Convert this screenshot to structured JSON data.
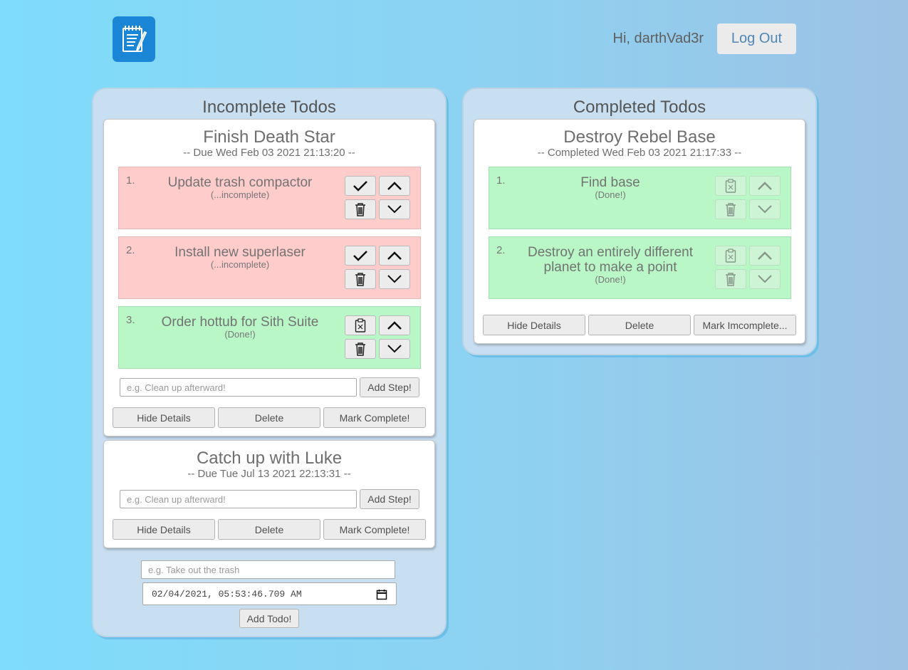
{
  "header": {
    "logo_icon": "notepad-pencil-icon",
    "greeting": "Hi, darthVad3r",
    "logout_label": "Log Out"
  },
  "incomplete": {
    "title": "Incomplete Todos",
    "todos": [
      {
        "title": "Finish Death Star",
        "subtitle": "-- Due Wed Feb 03 2021 21:13:20 --",
        "steps": [
          {
            "num": "1.",
            "title": "Update trash compactor",
            "status": "(...incomplete)",
            "state": "incomplete"
          },
          {
            "num": "2.",
            "title": "Install new superlaser",
            "status": "(...incomplete)",
            "state": "incomplete"
          },
          {
            "num": "3.",
            "title": "Order hottub for Sith Suite",
            "status": "(Done!)",
            "state": "done"
          }
        ],
        "step_placeholder": "e.g. Clean up afterward!",
        "add_step_label": "Add Step!",
        "hide_label": "Hide Details",
        "delete_label": "Delete",
        "mark_label": "Mark Complete!"
      },
      {
        "title": "Catch up with Luke",
        "subtitle": "-- Due Tue Jul 13 2021 22:13:31 --",
        "steps": [],
        "step_placeholder": "e.g. Clean up afterward!",
        "add_step_label": "Add Step!",
        "hide_label": "Hide Details",
        "delete_label": "Delete",
        "mark_label": "Mark Complete!"
      }
    ],
    "new_todo": {
      "placeholder": "e.g. Take out the trash",
      "date_value": "02/04/2021, 05:53:46.709 AM",
      "add_label": "Add Todo!"
    }
  },
  "completed": {
    "title": "Completed Todos",
    "todos": [
      {
        "title": "Destroy Rebel Base",
        "subtitle": "-- Completed Wed Feb 03 2021 21:17:33 --",
        "steps": [
          {
            "num": "1.",
            "title": "Find base",
            "status": "(Done!)",
            "state": "done"
          },
          {
            "num": "2.",
            "title": "Destroy an entirely different planet to make a point",
            "status": "(Done!)",
            "state": "done"
          }
        ],
        "hide_label": "Hide Details",
        "delete_label": "Delete",
        "mark_label": "Mark Imcomplete..."
      }
    ]
  },
  "colors": {
    "incomplete_step": "#ffcccc",
    "done_step": "#b9f7c6",
    "panel": "#c7dff1",
    "logo": "#1b86d6"
  }
}
